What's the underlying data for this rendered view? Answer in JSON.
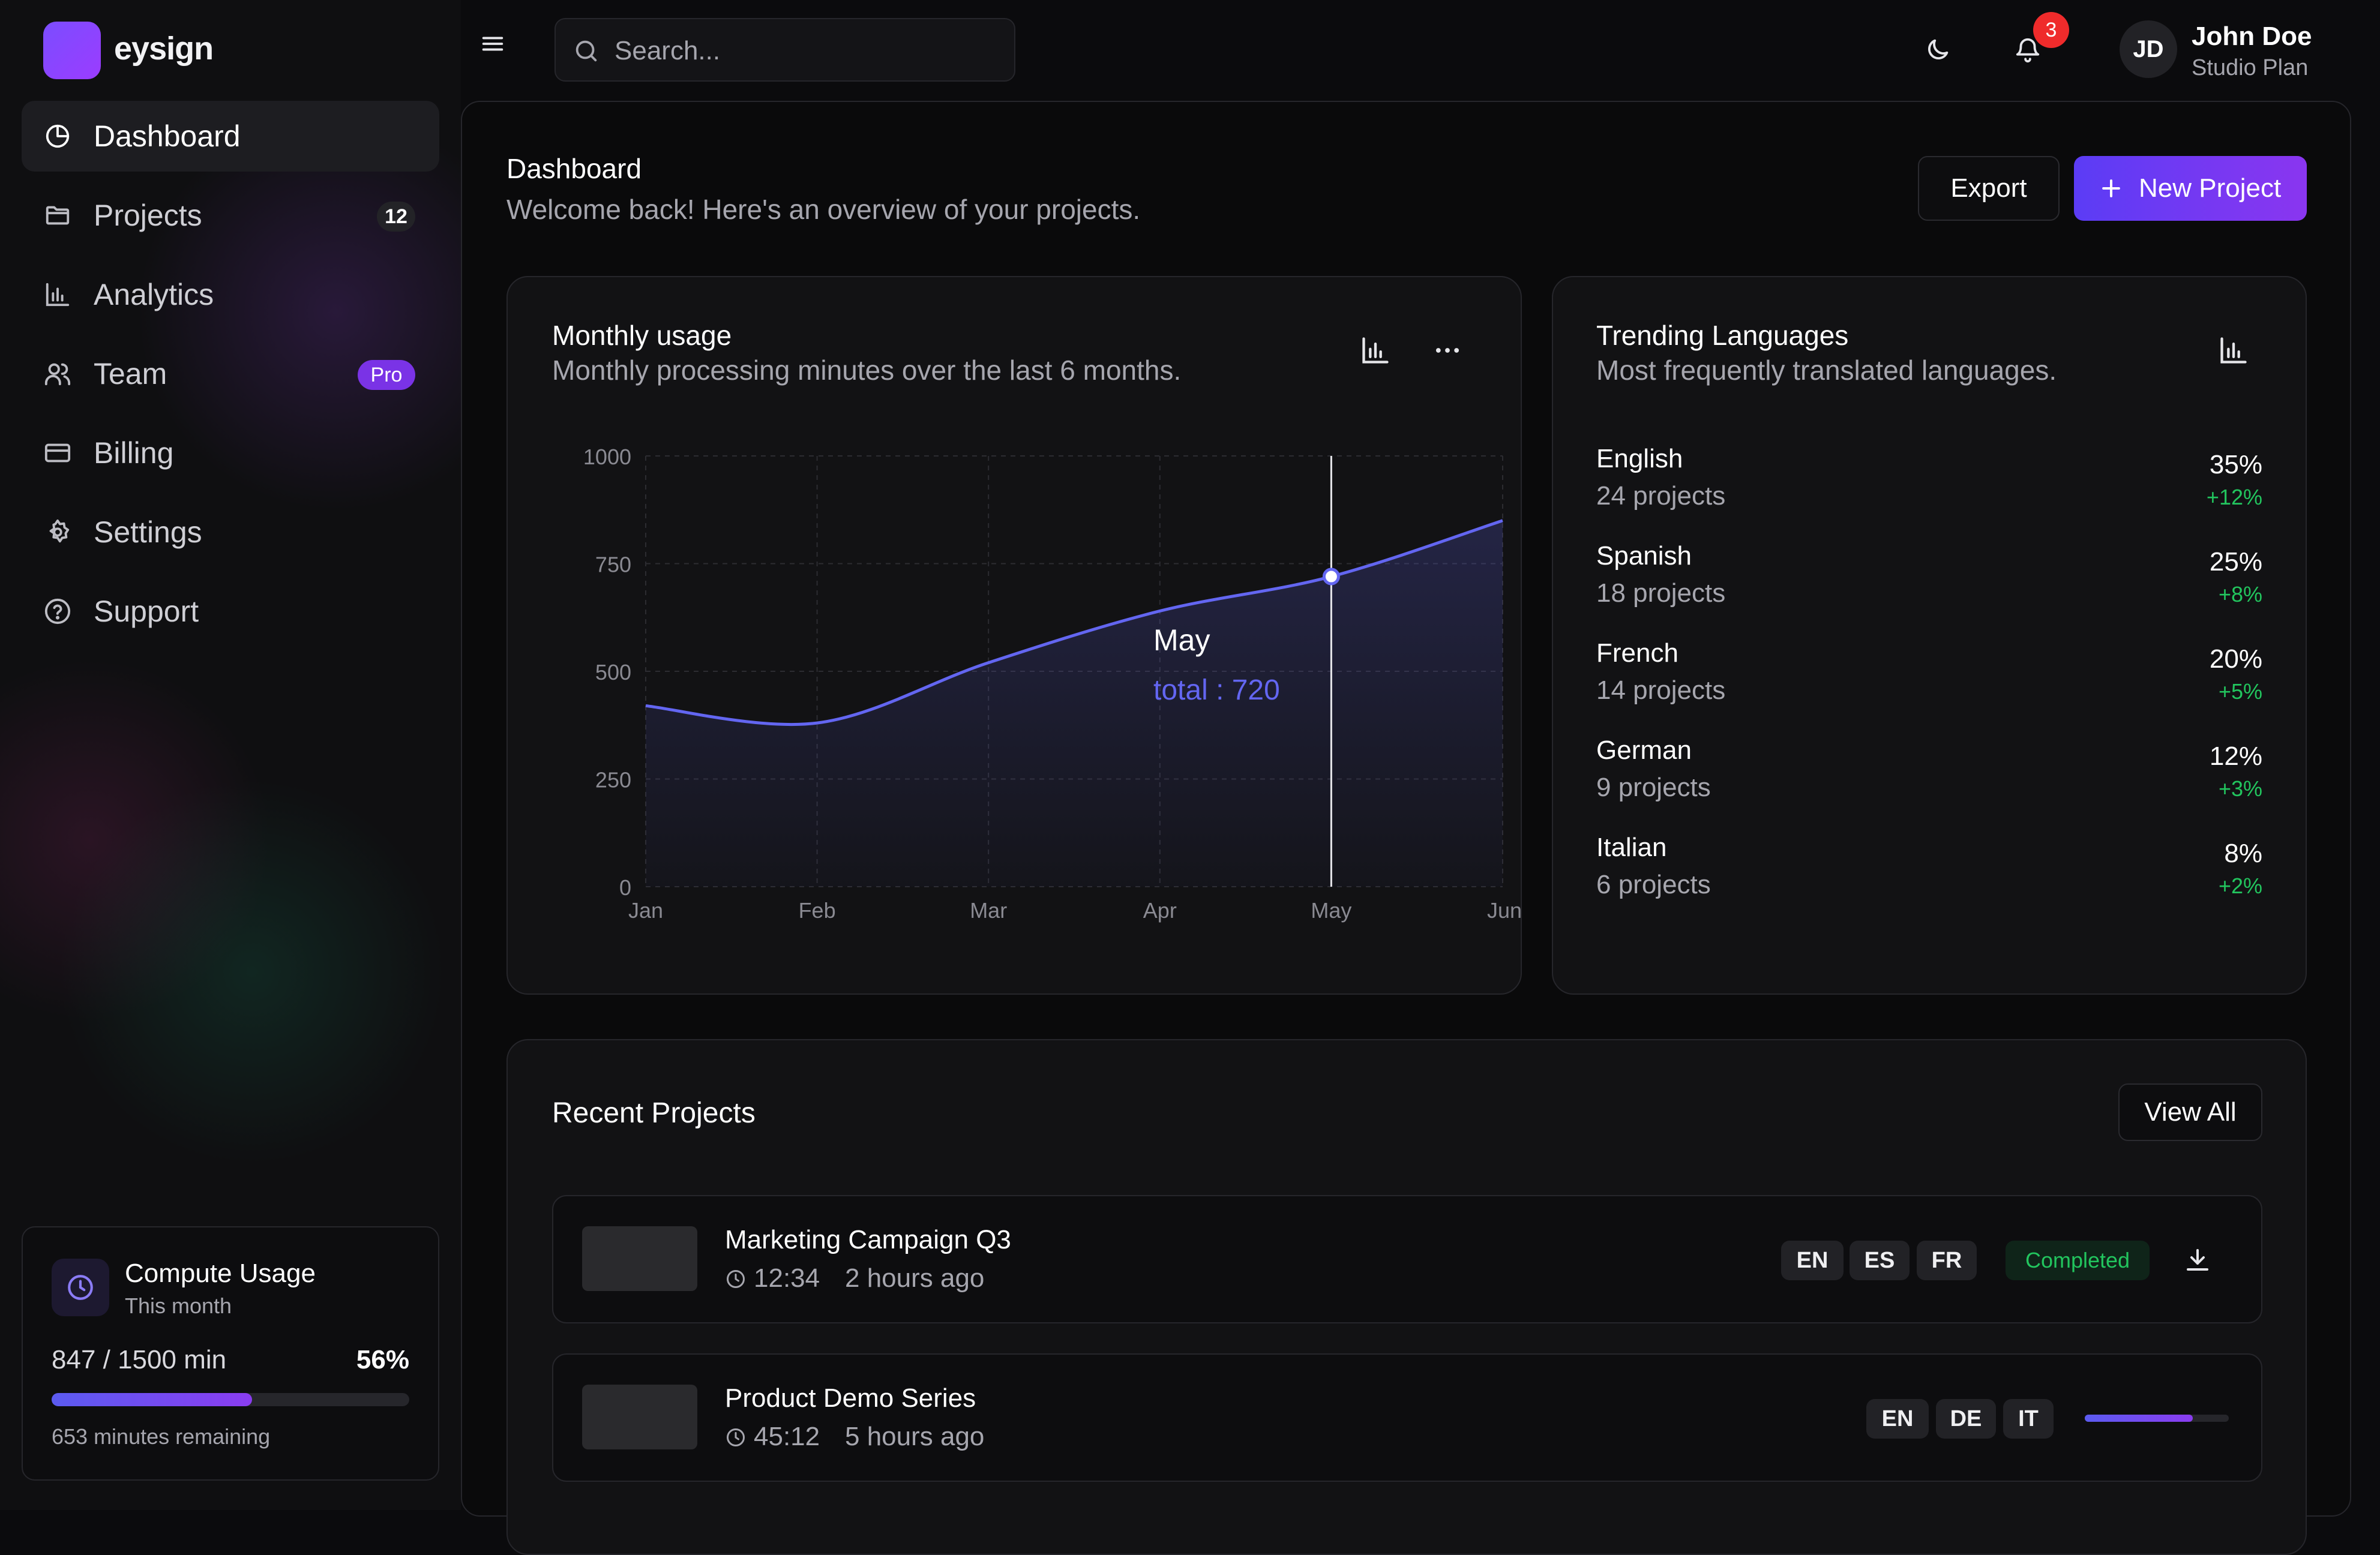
{
  "brand": {
    "name": "eysign"
  },
  "sidebar": {
    "items": [
      {
        "label": "Dashboard",
        "icon": "pie-chart-icon"
      },
      {
        "label": "Projects",
        "icon": "folder-icon",
        "badge": "12"
      },
      {
        "label": "Analytics",
        "icon": "bar-chart-icon"
      },
      {
        "label": "Team",
        "icon": "users-icon",
        "badge": "Pro"
      },
      {
        "label": "Billing",
        "icon": "credit-card-icon"
      },
      {
        "label": "Settings",
        "icon": "gear-icon"
      },
      {
        "label": "Support",
        "icon": "help-circle-icon"
      }
    ],
    "usage": {
      "title": "Compute Usage",
      "subtitle": "This month",
      "amount": "847 / 1500 min",
      "percent_label": "56%",
      "progress": 0.56,
      "remaining": "653 minutes remaining"
    }
  },
  "header": {
    "search_placeholder": "Search...",
    "notification_count": "3",
    "user": {
      "initials": "JD",
      "name": "John Doe",
      "plan": "Studio Plan"
    }
  },
  "page": {
    "title": "Dashboard",
    "subtitle": "Welcome back! Here's an overview of your projects.",
    "export_label": "Export",
    "new_project_label": "New Project"
  },
  "monthly_usage": {
    "title": "Monthly usage",
    "subtitle": "Monthly processing minutes over the last 6 months.",
    "tooltip_month": "May",
    "tooltip_value": "total : 720"
  },
  "chart_data": {
    "type": "area",
    "x": [
      "Jan",
      "Feb",
      "Mar",
      "Apr",
      "May",
      "Jun"
    ],
    "series": [
      {
        "values": [
          420,
          380,
          520,
          640,
          720,
          850
        ]
      }
    ],
    "y_ticks": [
      0,
      250,
      500,
      750,
      1000
    ],
    "ylim": [
      0,
      1000
    ],
    "grid": true,
    "highlight_index": 4,
    "color": "#6366f1"
  },
  "trending": {
    "title": "Trending Languages",
    "subtitle": "Most frequently translated languages.",
    "languages": [
      {
        "name": "English",
        "projects": "24 projects",
        "percent": "35%",
        "change": "+12%"
      },
      {
        "name": "Spanish",
        "projects": "18 projects",
        "percent": "25%",
        "change": "+8%"
      },
      {
        "name": "French",
        "projects": "14 projects",
        "percent": "20%",
        "change": "+5%"
      },
      {
        "name": "German",
        "projects": "9 projects",
        "percent": "12%",
        "change": "+3%"
      },
      {
        "name": "Italian",
        "projects": "6 projects",
        "percent": "8%",
        "change": "+2%"
      }
    ]
  },
  "recent": {
    "title": "Recent Projects",
    "view_all_label": "View All",
    "projects": [
      {
        "name": "Marketing Campaign Q3",
        "duration": "12:34",
        "time": "2 hours ago",
        "langs": [
          "EN",
          "ES",
          "FR"
        ],
        "status": "Completed"
      },
      {
        "name": "Product Demo Series",
        "duration": "45:12",
        "time": "5 hours ago",
        "langs": [
          "EN",
          "DE",
          "IT"
        ],
        "progress": 0.75
      }
    ]
  },
  "colors": {
    "accent": "#7c3aed",
    "accent_blue": "#5b5bf0",
    "success": "#22c55e",
    "notification": "#ef2b2b",
    "chart_line": "#6366f1"
  }
}
